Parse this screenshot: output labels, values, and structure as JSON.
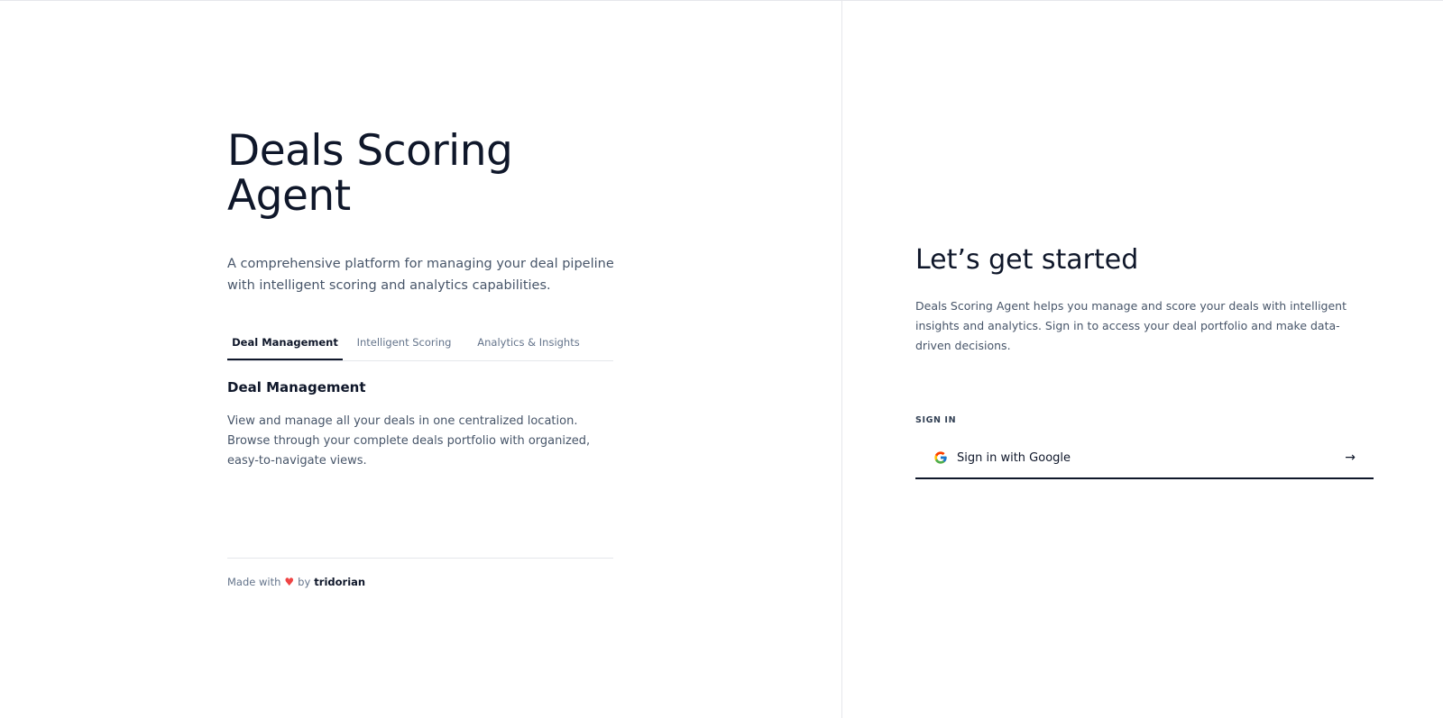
{
  "left": {
    "title": "Deals Scoring Agent",
    "subtitle": "A comprehensive platform for managing your deal pipeline with intelligent scoring and analytics capabilities.",
    "tabs": [
      {
        "label": "Deal Management",
        "active": true
      },
      {
        "label": "Intelligent Scoring",
        "active": false
      },
      {
        "label": "Analytics & Insights",
        "active": false
      }
    ],
    "panel": {
      "heading": "Deal Management",
      "body": "View and manage all your deals in one centralized location. Browse through your complete deals portfolio with organized, easy-to-navigate views."
    },
    "footer": {
      "prefix": "Made with",
      "heart": "♥",
      "by": "by",
      "brand": "tridorian"
    }
  },
  "right": {
    "title": "Let’s get started",
    "description": "Deals Scoring Agent helps you manage and score your deals with intelligent insights and analytics. Sign in to access your deal portfolio and make data-driven decisions.",
    "signin_label": "SIGN IN",
    "signin_button": "Sign in with Google",
    "signin_icon": "google-icon",
    "arrow": "→"
  },
  "colors": {
    "text_primary": "#0f172a",
    "text_secondary": "#475569",
    "border": "#e5e7eb",
    "heart": "#ef4444"
  }
}
